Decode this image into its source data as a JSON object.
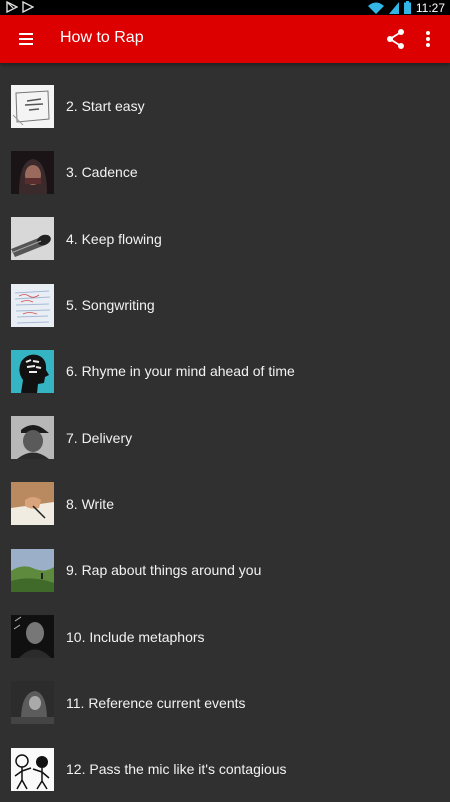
{
  "status_bar": {
    "time": "11:27",
    "left_icons": [
      "play-store-notification-icon",
      "play-notification-icon"
    ],
    "right_icons": [
      "wifi-icon",
      "signal-icon",
      "battery-icon"
    ]
  },
  "app_bar": {
    "title": "How to Rap",
    "accent_color": "#dd0000",
    "icons": [
      "menu-icon",
      "share-icon",
      "more-vert-icon"
    ]
  },
  "list": {
    "items": [
      {
        "label": "2. Start easy",
        "thumb": "sketch-paper-thumbnail"
      },
      {
        "label": "3. Cadence",
        "thumb": "hooded-face-thumbnail"
      },
      {
        "label": "4. Keep flowing",
        "thumb": "microphone-thumbnail"
      },
      {
        "label": "5. Songwriting",
        "thumb": "handwritten-notes-thumbnail"
      },
      {
        "label": "6. Rhyme in your mind ahead of time",
        "thumb": "head-silhouette-thumbnail"
      },
      {
        "label": "7. Delivery",
        "thumb": "rapper-cap-thumbnail"
      },
      {
        "label": "8. Write",
        "thumb": "hand-writing-thumbnail"
      },
      {
        "label": "9. Rap about things around you",
        "thumb": "landscape-thumbnail"
      },
      {
        "label": "10. Include metaphors",
        "thumb": "dark-portrait-thumbnail"
      },
      {
        "label": "11. Reference current events",
        "thumb": "hooded-figure-thumbnail"
      },
      {
        "label": "12. Pass the mic like it's contagious",
        "thumb": "cartoon-figures-thumbnail"
      }
    ]
  }
}
